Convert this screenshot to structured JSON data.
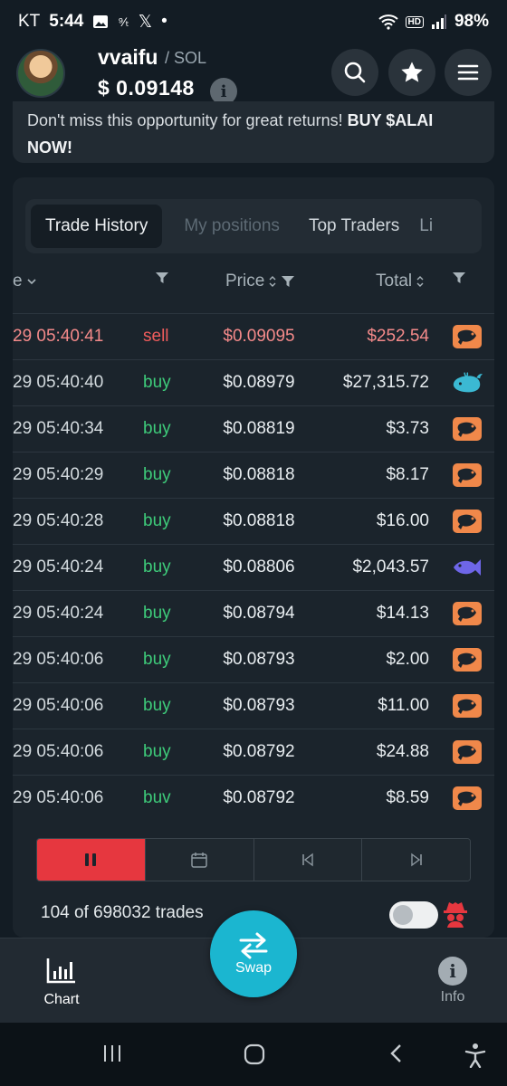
{
  "status_bar": {
    "carrier": "KT",
    "time": "5:44",
    "battery": "98%"
  },
  "header": {
    "token_name": "vvaifu",
    "chain": "/ SOL",
    "price": "$ 0.09148"
  },
  "banner": {
    "text": "Don't miss this opportunity for great returns!",
    "cta": "BUY $ALAI NOW!"
  },
  "tabs": [
    "Trade History",
    "My positions",
    "Top Traders",
    "Li"
  ],
  "columns": {
    "date_partial": "e",
    "price": "Price",
    "total": "Total"
  },
  "trades": [
    {
      "time": "29 05:40:41",
      "side": "sell",
      "price": "$0.09095",
      "total": "$252.54",
      "tier": "shrimp-icon"
    },
    {
      "time": "29 05:40:40",
      "side": "buy",
      "price": "$0.08979",
      "total": "$27,315.72",
      "tier": "whale-icon"
    },
    {
      "time": "29 05:40:34",
      "side": "buy",
      "price": "$0.08819",
      "total": "$3.73",
      "tier": "shrimp-icon"
    },
    {
      "time": "29 05:40:29",
      "side": "buy",
      "price": "$0.08818",
      "total": "$8.17",
      "tier": "shrimp-icon"
    },
    {
      "time": "29 05:40:28",
      "side": "buy",
      "price": "$0.08818",
      "total": "$16.00",
      "tier": "shrimp-icon"
    },
    {
      "time": "29 05:40:24",
      "side": "buy",
      "price": "$0.08806",
      "total": "$2,043.57",
      "tier": "fish-icon"
    },
    {
      "time": "29 05:40:24",
      "side": "buy",
      "price": "$0.08794",
      "total": "$14.13",
      "tier": "shrimp-icon"
    },
    {
      "time": "29 05:40:06",
      "side": "buy",
      "price": "$0.08793",
      "total": "$2.00",
      "tier": "shrimp-icon"
    },
    {
      "time": "29 05:40:06",
      "side": "buy",
      "price": "$0.08793",
      "total": "$11.00",
      "tier": "shrimp-icon"
    },
    {
      "time": "29 05:40:06",
      "side": "buy",
      "price": "$0.08792",
      "total": "$24.88",
      "tier": "shrimp-icon"
    },
    {
      "time": "29 05:40:06",
      "side": "buv",
      "price": "$0.08792",
      "total": "$8.59",
      "tier": "shrimp-icon"
    }
  ],
  "footer": {
    "trade_count": "104 of 698032 trades"
  },
  "bottom_nav": {
    "chart": "Chart",
    "swap": "Swap",
    "info": "Info"
  },
  "colors": {
    "sell": "#f05c5c",
    "buy": "#3ecb7a",
    "accent": "#1bb6d0",
    "pause": "#e6373f"
  }
}
